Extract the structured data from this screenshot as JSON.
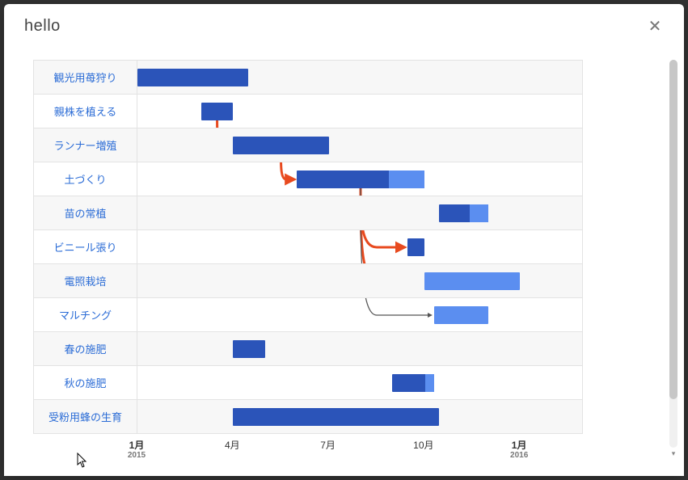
{
  "dialog": {
    "title": "hello",
    "close_label": "✕"
  },
  "chart_data": {
    "type": "gantt",
    "time_unit": "month",
    "range_start": "2015-01",
    "range_end": "2016-03",
    "tasks": [
      {
        "id": "t1",
        "label": "観光用苺狩り",
        "start": "2015-01",
        "end": "2015-04-15",
        "color": "#2b54b9",
        "depends_on": []
      },
      {
        "id": "t2",
        "label": "親株を植える",
        "start": "2015-03",
        "end": "2015-04",
        "color": "#2b54b9",
        "depends_on": []
      },
      {
        "id": "t3",
        "label": "ランナー増殖",
        "start": "2015-04",
        "end": "2015-07",
        "color": "#2b54b9",
        "depends_on": [
          "t2"
        ]
      },
      {
        "id": "t4",
        "label": "土づくり",
        "start": "2015-06",
        "end": "2015-10",
        "color": "#2b54b9",
        "progress_split": 0.72,
        "depends_on": [
          "t3"
        ]
      },
      {
        "id": "t5",
        "label": "苗の常植",
        "start": "2015-10-15",
        "end": "2015-12",
        "color": "#2b54b9",
        "progress_split": 0.62,
        "depends_on": [
          "t4"
        ]
      },
      {
        "id": "t6",
        "label": "ビニール張り",
        "start": "2015-09-15",
        "end": "2015-10",
        "color": "#2b54b9",
        "depends_on": [
          "t4"
        ]
      },
      {
        "id": "t7",
        "label": "電照栽培",
        "start": "2015-10",
        "end": "2016-01",
        "color": "#5b8ef0",
        "depends_on": [
          "t4"
        ]
      },
      {
        "id": "t8",
        "label": "マルチング",
        "start": "2015-10-10",
        "end": "2015-12",
        "color": "#5b8ef0",
        "depends_on": [
          "t4"
        ]
      },
      {
        "id": "t9",
        "label": "春の施肥",
        "start": "2015-04",
        "end": "2015-05",
        "color": "#2b54b9",
        "depends_on": []
      },
      {
        "id": "t10",
        "label": "秋の施肥",
        "start": "2015-09",
        "end": "2015-10-10",
        "color": "#2b54b9",
        "progress_split": 0.8,
        "depends_on": []
      },
      {
        "id": "t11",
        "label": "受粉用蜂の生育",
        "start": "2015-04",
        "end": "2015-10-15",
        "color": "#2b54b9",
        "depends_on": []
      }
    ],
    "dependency_style": {
      "critical_color": "#e84a1f",
      "noncritical_color": "#555"
    },
    "axis_ticks": [
      {
        "label": "1月",
        "at": "2015-01",
        "major": true,
        "year": "2015"
      },
      {
        "label": "4月",
        "at": "2015-04",
        "major": false
      },
      {
        "label": "7月",
        "at": "2015-07",
        "major": false
      },
      {
        "label": "10月",
        "at": "2015-10",
        "major": false
      },
      {
        "label": "1月",
        "at": "2016-01",
        "major": true,
        "year": "2016"
      }
    ]
  }
}
